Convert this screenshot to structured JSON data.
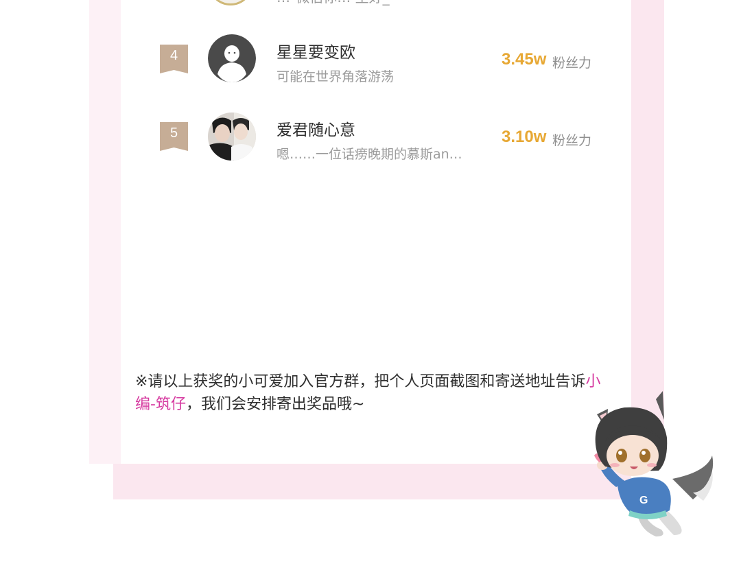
{
  "colors": {
    "accent_score": "#e7a834",
    "highlight": "#d63aa0",
    "rank_badge": "#c6ad96",
    "pink_frame": "#fbe7ef"
  },
  "previous_row": {
    "bio_partial": "…ᵕ微信你… 里好_ ᵕ"
  },
  "leaderboard": [
    {
      "rank": "4",
      "name": "星星要变欧",
      "bio": "可能在世界角落游荡",
      "score": "3.45w",
      "score_label": "粉丝力",
      "avatar": "default-person-icon"
    },
    {
      "rank": "5",
      "name": "爱君随心意",
      "bio": "嗯……一位话痨晚期的慕斯an…",
      "score": "3.10w",
      "score_label": "粉丝力",
      "avatar": "photo-avatar"
    }
  ],
  "notice": {
    "part1": "※请以上获奖的小可爱加入官方群，把个人页面截图和寄送地址告诉",
    "highlight": "小编-筑仔",
    "part2": "，我们会安排寄出奖品哦~"
  }
}
